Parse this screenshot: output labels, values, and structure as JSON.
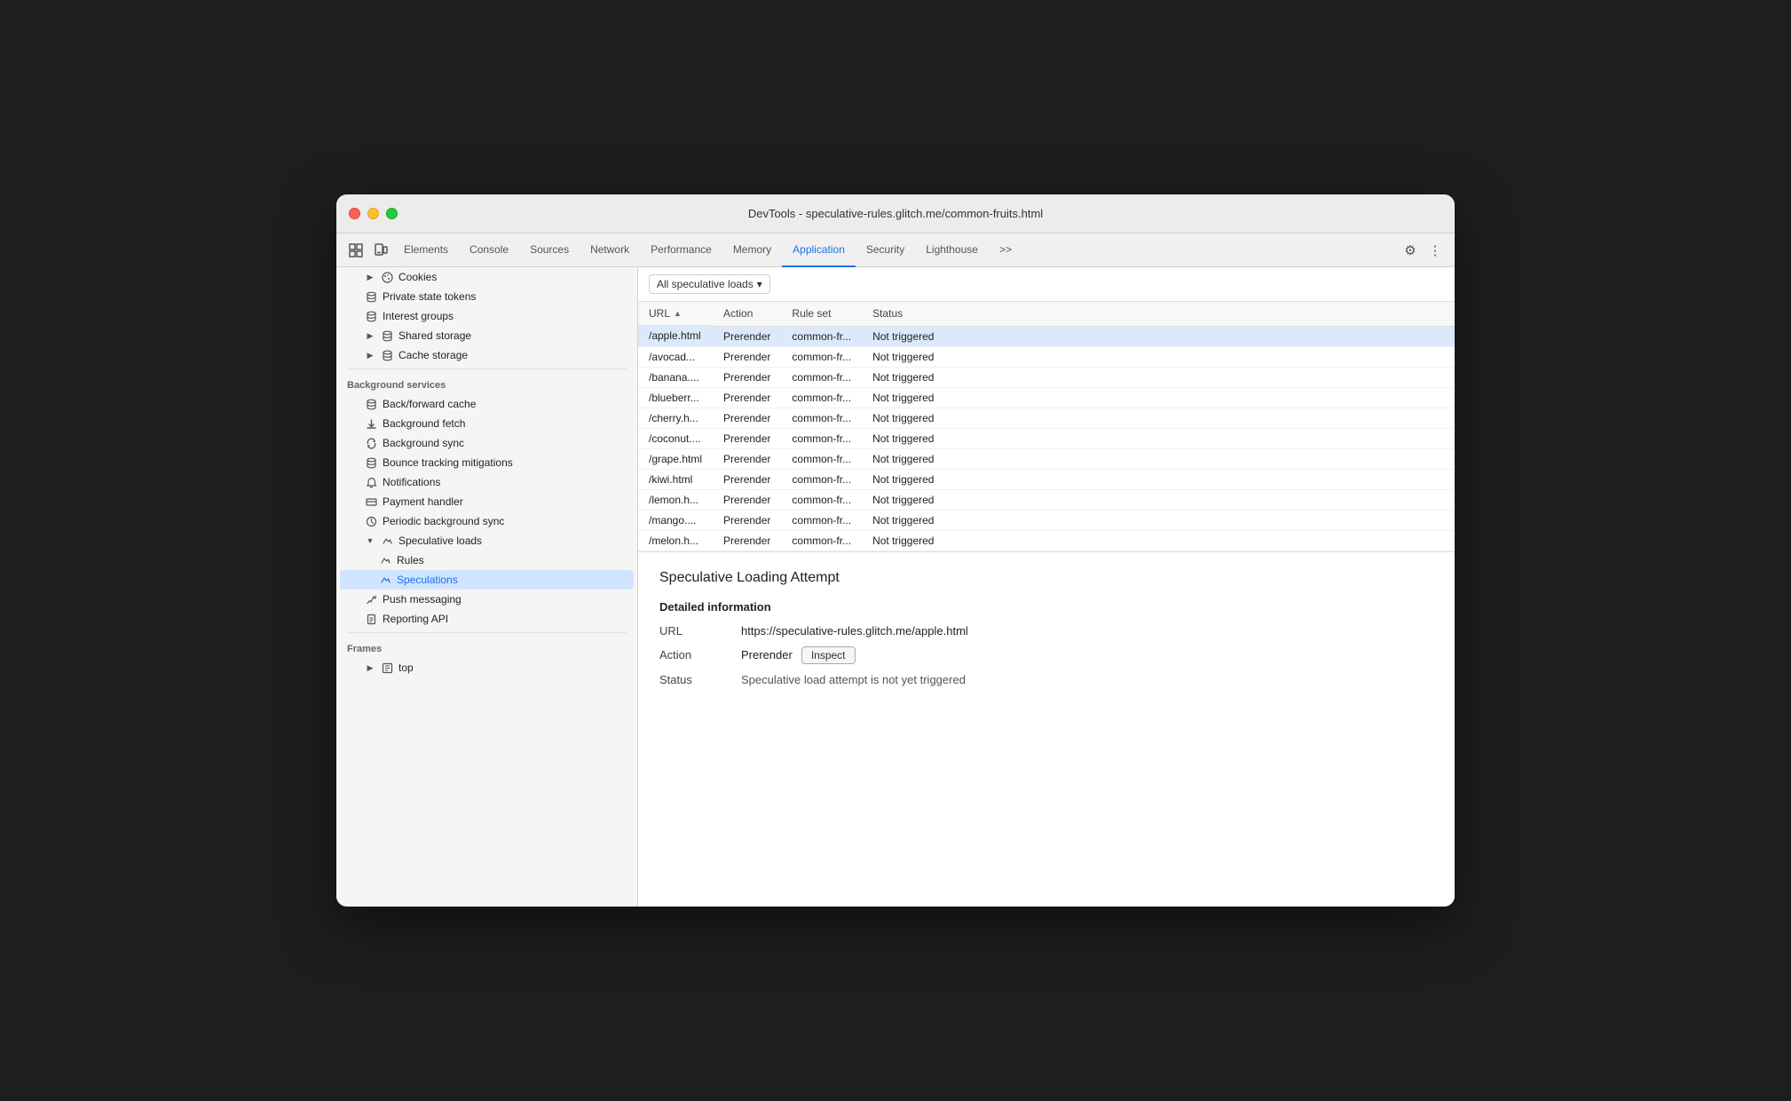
{
  "window": {
    "title": "DevTools - speculative-rules.glitch.me/common-fruits.html"
  },
  "tabs": [
    {
      "label": "Elements",
      "active": false
    },
    {
      "label": "Console",
      "active": false
    },
    {
      "label": "Sources",
      "active": false
    },
    {
      "label": "Network",
      "active": false
    },
    {
      "label": "Performance",
      "active": false
    },
    {
      "label": "Memory",
      "active": false
    },
    {
      "label": "Application",
      "active": true
    },
    {
      "label": "Security",
      "active": false
    },
    {
      "label": "Lighthouse",
      "active": false
    }
  ],
  "sidebar": {
    "cookies_label": "Cookies",
    "private_state_tokens": "Private state tokens",
    "interest_groups": "Interest groups",
    "shared_storage": "Shared storage",
    "cache_storage": "Cache storage",
    "background_services_label": "Background services",
    "back_forward_cache": "Back/forward cache",
    "background_fetch": "Background fetch",
    "background_sync": "Background sync",
    "bounce_tracking": "Bounce tracking mitigations",
    "notifications": "Notifications",
    "payment_handler": "Payment handler",
    "periodic_background_sync": "Periodic background sync",
    "speculative_loads": "Speculative loads",
    "rules": "Rules",
    "speculations": "Speculations",
    "push_messaging": "Push messaging",
    "reporting_api": "Reporting API",
    "frames_label": "Frames",
    "top": "top"
  },
  "filter": {
    "label": "All speculative loads",
    "dropdown_arrow": "▾"
  },
  "table": {
    "columns": [
      "URL",
      "Action",
      "Rule set",
      "Status"
    ],
    "rows": [
      {
        "url": "/apple.html",
        "action": "Prerender",
        "ruleset": "common-fr...",
        "status": "Not triggered",
        "selected": true
      },
      {
        "url": "/avocad...",
        "action": "Prerender",
        "ruleset": "common-fr...",
        "status": "Not triggered",
        "selected": false
      },
      {
        "url": "/banana....",
        "action": "Prerender",
        "ruleset": "common-fr...",
        "status": "Not triggered",
        "selected": false
      },
      {
        "url": "/blueberr...",
        "action": "Prerender",
        "ruleset": "common-fr...",
        "status": "Not triggered",
        "selected": false
      },
      {
        "url": "/cherry.h...",
        "action": "Prerender",
        "ruleset": "common-fr...",
        "status": "Not triggered",
        "selected": false
      },
      {
        "url": "/coconut....",
        "action": "Prerender",
        "ruleset": "common-fr...",
        "status": "Not triggered",
        "selected": false
      },
      {
        "url": "/grape.html",
        "action": "Prerender",
        "ruleset": "common-fr...",
        "status": "Not triggered",
        "selected": false
      },
      {
        "url": "/kiwi.html",
        "action": "Prerender",
        "ruleset": "common-fr...",
        "status": "Not triggered",
        "selected": false
      },
      {
        "url": "/lemon.h...",
        "action": "Prerender",
        "ruleset": "common-fr...",
        "status": "Not triggered",
        "selected": false
      },
      {
        "url": "/mango....",
        "action": "Prerender",
        "ruleset": "common-fr...",
        "status": "Not triggered",
        "selected": false
      },
      {
        "url": "/melon.h...",
        "action": "Prerender",
        "ruleset": "common-fr...",
        "status": "Not triggered",
        "selected": false
      }
    ]
  },
  "detail": {
    "title": "Speculative Loading Attempt",
    "section_title": "Detailed information",
    "url_label": "URL",
    "url_value": "https://speculative-rules.glitch.me/apple.html",
    "action_label": "Action",
    "action_value": "Prerender",
    "inspect_label": "Inspect",
    "status_label": "Status",
    "status_value": "Speculative load attempt is not yet triggered"
  },
  "colors": {
    "active_tab": "#1a73e8",
    "selected_row": "#d0e4ff",
    "selected_row_border": "#4a90d9"
  }
}
